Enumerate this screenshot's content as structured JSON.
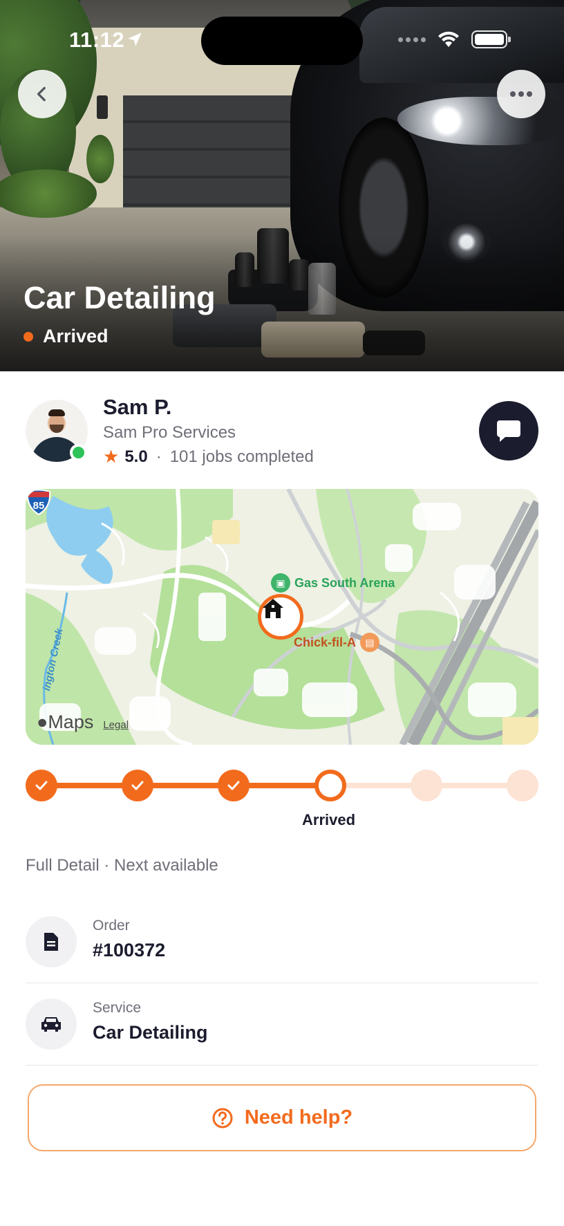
{
  "status_bar": {
    "time": "11:12"
  },
  "hero": {
    "title": "Car Detailing",
    "status": "Arrived"
  },
  "provider": {
    "name": "Sam P.",
    "company": "Sam Pro Services",
    "rating": "5.0",
    "separator": "·",
    "jobs": "101 jobs completed",
    "online": true
  },
  "map": {
    "poi_arena": "Gas South Arena",
    "poi_restaurant": "Chick-fil-A",
    "highway": "85",
    "creek": "ington Creek",
    "brand": "Maps",
    "legal": "Legal"
  },
  "progress": {
    "steps_total": 6,
    "current_step_index": 3,
    "current_label": "Arrived"
  },
  "order_summary": "Full Detail · Next available",
  "details": [
    {
      "label": "Order",
      "value": "#100372",
      "icon": "document-icon"
    },
    {
      "label": "Service",
      "value": "Car Detailing",
      "icon": "car-icon"
    }
  ],
  "help_button": {
    "label": "Need help?"
  },
  "colors": {
    "accent": "#f26b1d",
    "accent_light": "#fde3d4",
    "dark": "#1b1c2e",
    "online": "#2ec35a"
  }
}
